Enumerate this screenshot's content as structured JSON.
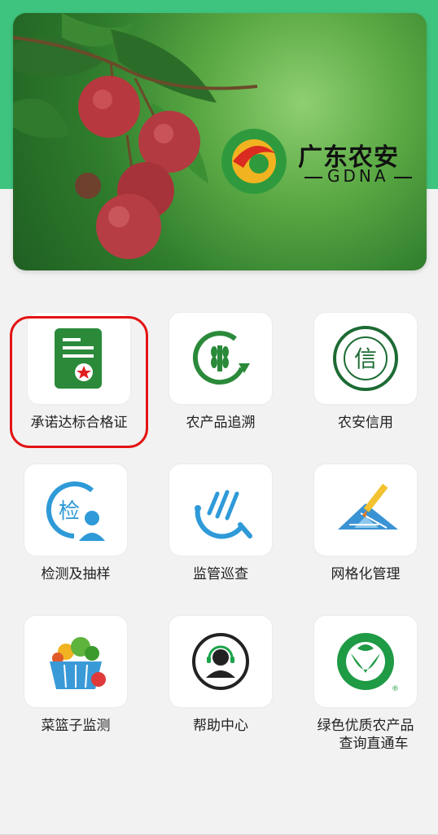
{
  "banner": {
    "brand_cn": "广东农安",
    "brand_en": "GDNA"
  },
  "menu": [
    {
      "label": "承诺达标合格证",
      "icon": "certificate-icon",
      "highlighted": true
    },
    {
      "label": "农产品追溯",
      "icon": "wheat-trace-icon"
    },
    {
      "label": "农安信用",
      "icon": "credit-seal-icon"
    },
    {
      "label": "检测及抽样",
      "icon": "inspection-person-icon"
    },
    {
      "label": "监管巡查",
      "icon": "patrol-search-icon"
    },
    {
      "label": "网格化管理",
      "icon": "grid-pencil-icon"
    },
    {
      "label": "菜篮子监测",
      "icon": "vegetable-basket-icon"
    },
    {
      "label": "帮助中心",
      "icon": "headset-support-icon"
    },
    {
      "label": "绿色优质农产品",
      "label2": "查询直通车",
      "icon": "green-food-logo-icon"
    }
  ],
  "colors": {
    "accent_green": "#3fc47f",
    "highlight_red": "#e41414",
    "icon_green": "#2a8a3a",
    "icon_blue": "#2f9ad8"
  }
}
